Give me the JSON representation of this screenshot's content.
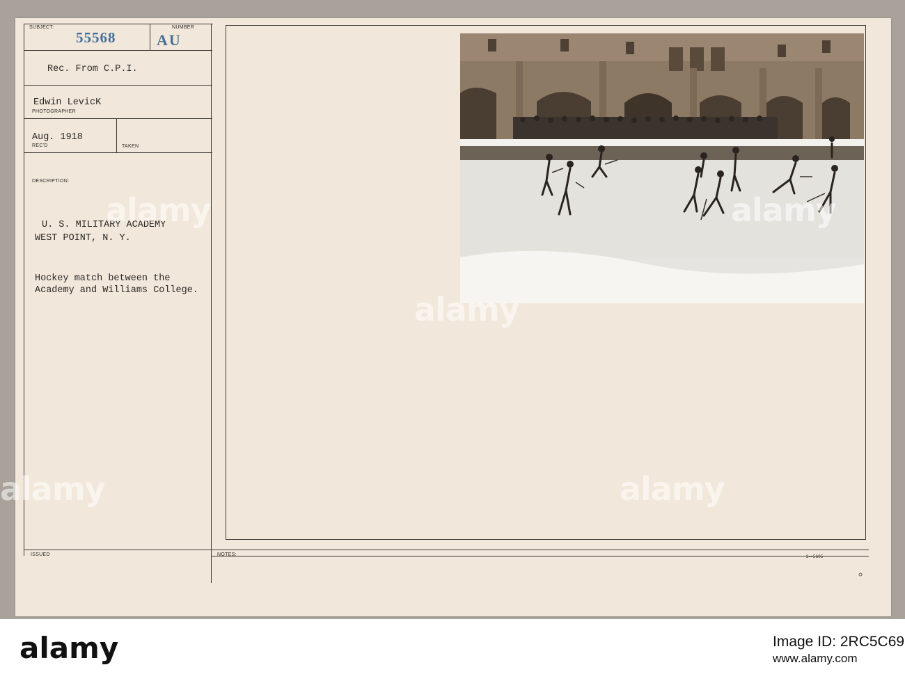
{
  "card": {
    "subject_label": "SUBJECT:",
    "subject_number": "55568",
    "number_label": "NUMBER",
    "number_code": "AU",
    "received_from": "Rec. From C.P.I.",
    "photographer_name": "Edwin LevicK",
    "photographer_label": "PHOTOGRAPHER",
    "date": "Aug. 1918",
    "recd_label": "REC'D",
    "taken_label": "TAKEN",
    "description_label": "DESCRIPTION:",
    "description_line1": "U. S. MILITARY ACADEMY",
    "description_line2": "WEST POINT, N. Y.",
    "caption_line1": "Hockey match between the",
    "caption_line2": "Academy and Williams College.",
    "issued_label": "ISSUED",
    "notes_label": "NOTES:",
    "form_code": "3—5605"
  },
  "watermark": "alamy",
  "footer": {
    "brand": "alamy",
    "image_id": "Image ID: 2RC5C69",
    "url": "www.alamy.com"
  }
}
